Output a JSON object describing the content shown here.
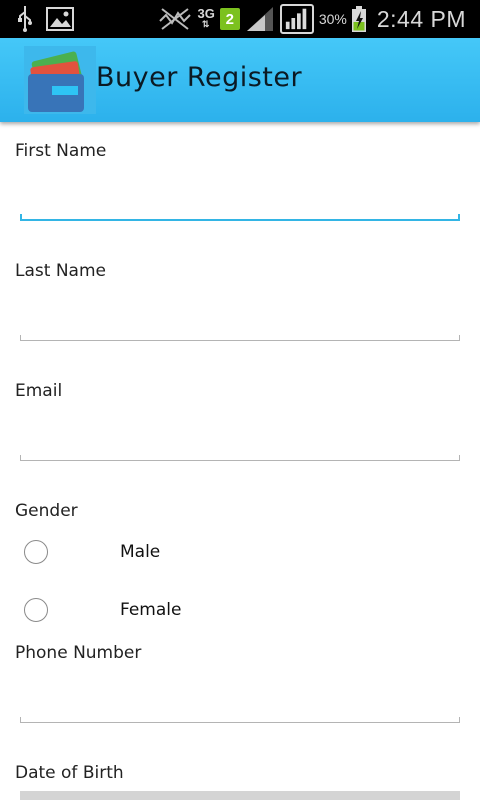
{
  "status_bar": {
    "network_type": "3G",
    "sim_slot": "2",
    "battery_percent": "30%",
    "time": "2:44 PM",
    "icons": [
      "usb-icon",
      "image-icon",
      "mute-icon",
      "data-arrows-icon",
      "signal-icon",
      "signal-icon",
      "battery-charging-icon"
    ]
  },
  "app_bar": {
    "title": "Buyer Register",
    "logo": "wallet-icon",
    "color": "#3cc0f5"
  },
  "form": {
    "first_name_label": "First Name",
    "first_name_value": "",
    "last_name_label": "Last Name",
    "last_name_value": "",
    "email_label": "Email",
    "email_value": "",
    "gender_label": "Gender",
    "gender_options": [
      {
        "label": "Male",
        "selected": false
      },
      {
        "label": "Female",
        "selected": false
      }
    ],
    "phone_label": "Phone Number",
    "phone_value": "",
    "dob_label": "Date of Birth"
  },
  "colors": {
    "focus": "#33b5e5",
    "field_line": "#b4b4b4"
  }
}
